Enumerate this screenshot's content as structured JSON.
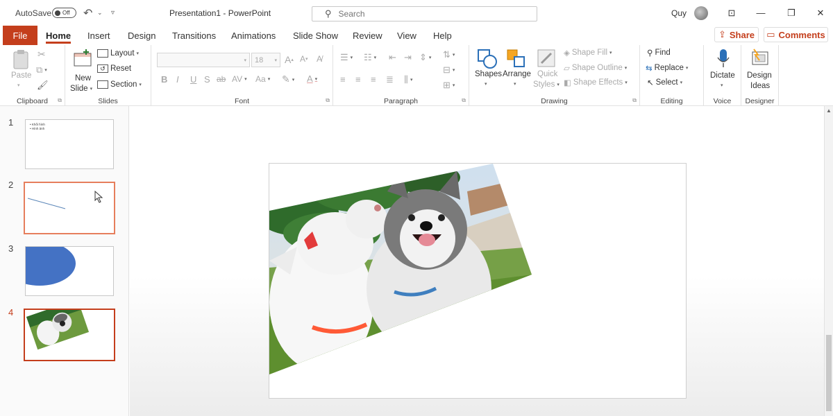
{
  "titlebar": {
    "autosave_label": "AutoSave",
    "autosave_state": "Off",
    "document_title": "Presentation1  -  PowerPoint",
    "search_placeholder": "Search",
    "user_name": "Quy"
  },
  "tabs": [
    "File",
    "Home",
    "Insert",
    "Design",
    "Transitions",
    "Animations",
    "Slide Show",
    "Review",
    "View",
    "Help"
  ],
  "active_tab": "Home",
  "share_label": "Share",
  "comments_label": "Comments",
  "ribbon": {
    "clipboard": {
      "paste": "Paste",
      "label": "Clipboard"
    },
    "slides": {
      "new_slide_1": "New",
      "new_slide_2": "Slide",
      "layout": "Layout",
      "reset": "Reset",
      "section": "Section",
      "label": "Slides"
    },
    "font": {
      "font_size": "18",
      "bold": "B",
      "italic": "I",
      "underline": "U",
      "shadow": "S",
      "strike": "ab",
      "spacing": "AV",
      "case": "Aa",
      "font_color": "A",
      "label": "Font"
    },
    "paragraph": {
      "label": "Paragraph"
    },
    "drawing": {
      "shapes": "Shapes",
      "arrange": "Arrange",
      "quick_styles_1": "Quick",
      "quick_styles_2": "Styles",
      "shape_fill": "Shape Fill",
      "shape_outline": "Shape Outline",
      "shape_effects": "Shape Effects",
      "label": "Drawing"
    },
    "editing": {
      "find": "Find",
      "replace": "Replace",
      "select": "Select",
      "label": "Editing"
    },
    "voice": {
      "dictate": "Dictate",
      "label": "Voice"
    },
    "designer": {
      "design_ideas_1": "Design",
      "design_ideas_2": "Ideas",
      "label": "Designer"
    }
  },
  "slides": [
    {
      "number": "1",
      "bullets": [
        "• Khối hình",
        "• Hình ảnh"
      ]
    },
    {
      "number": "2"
    },
    {
      "number": "3"
    },
    {
      "number": "4"
    }
  ],
  "colors": {
    "accent": "#c43e1c",
    "shape_blue": "#4472c4"
  }
}
